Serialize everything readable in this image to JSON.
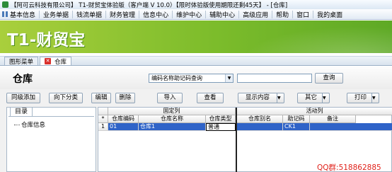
{
  "window": {
    "title": "【阿可云科技有限公司】 T1-财贸宝体验版（客户端 V 10.0）【限时体验版使用期限还剩45天】 - [仓库]"
  },
  "menubar": {
    "items": [
      "基本信息",
      "业务单据",
      "钱流单据",
      "财务管理",
      "信息中心",
      "维护中心",
      "辅助中心",
      "高级应用",
      "帮助",
      "窗口",
      "我的桌面"
    ]
  },
  "banner": {
    "brand": "T1-财贸宝"
  },
  "tabs": [
    {
      "label": "图形菜单",
      "active": false
    },
    {
      "label": "仓库",
      "active": true
    }
  ],
  "page": {
    "title": "仓库",
    "query_select_value": "编码名称助记码查询",
    "query_input_value": "",
    "query_button": "查询"
  },
  "toolbar": {
    "add_same_level": "同级添加",
    "add_sub_category": "向下分类",
    "edit": "编辑",
    "delete": "删除",
    "import": "导入",
    "view": "查看",
    "display_content": "显示内容",
    "other": "其它",
    "print": "打印"
  },
  "tree": {
    "tab_label": "目录",
    "root_node": "仓库信息"
  },
  "grid": {
    "group_headers": {
      "fixed": "固定列",
      "active": "活动列"
    },
    "columns": [
      "仓库编码",
      "仓库名称",
      "仓库类型",
      "仓库别名",
      "助记码",
      "备注"
    ],
    "row_marker": "*",
    "rows": [
      {
        "num": "1",
        "code": "01",
        "name": "仓库1",
        "type": "普通",
        "alias": "",
        "mnemonic": "CK1",
        "note": ""
      }
    ]
  },
  "watermark": {
    "qq": "QQ群:518862885"
  },
  "colors": {
    "banner_green": "#7cbc2b",
    "selection_blue": "#2f63c8",
    "watermark_red": "#e0211a",
    "close_icon_red": "#d9302c"
  }
}
